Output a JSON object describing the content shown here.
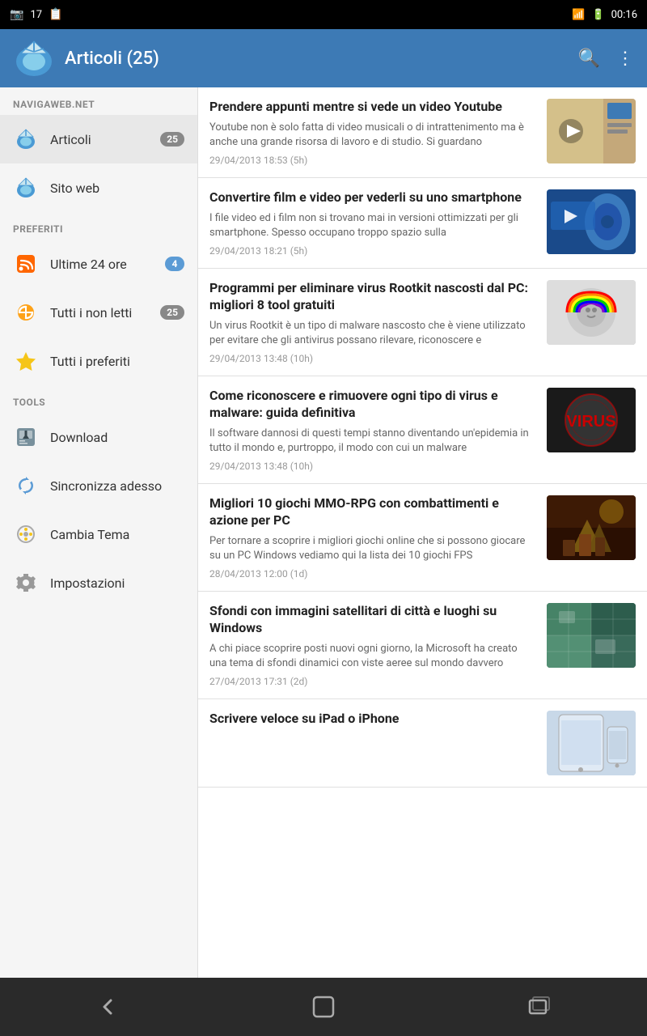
{
  "statusBar": {
    "leftIcons": [
      "📷",
      "17",
      "📋"
    ],
    "rightIcons": [
      "wifi",
      "battery",
      "time"
    ],
    "time": "00:16"
  },
  "topBar": {
    "title": "Articoli (25)",
    "searchLabel": "🔍",
    "menuLabel": "⋮"
  },
  "sidebar": {
    "sectionSite": "NAVIGAWEB.NET",
    "sectionFavorites": "PREFERITI",
    "sectionTools": "TOOLS",
    "items": [
      {
        "id": "articoli",
        "label": "Articoli",
        "badge": "25",
        "badgeClass": "badge",
        "icon": "articoli"
      },
      {
        "id": "sito-web",
        "label": "Sito web",
        "badge": "",
        "icon": "sito"
      },
      {
        "id": "ultime-24-ore",
        "label": "Ultime 24 ore",
        "badge": "4",
        "badgeClass": "badge blue",
        "icon": "rss"
      },
      {
        "id": "tutti-non-letti",
        "label": "Tutti i non letti",
        "badge": "25",
        "badgeClass": "badge",
        "icon": "wifi"
      },
      {
        "id": "tutti-preferiti",
        "label": "Tutti i preferiti",
        "badge": "",
        "icon": "star"
      },
      {
        "id": "download",
        "label": "Download",
        "badge": "",
        "icon": "download"
      },
      {
        "id": "sincronizza",
        "label": "Sincronizza adesso",
        "badge": "",
        "icon": "sync"
      },
      {
        "id": "cambia-tema",
        "label": "Cambia Tema",
        "badge": "",
        "icon": "theme"
      },
      {
        "id": "impostazioni",
        "label": "Impostazioni",
        "badge": "",
        "icon": "settings"
      }
    ]
  },
  "articles": [
    {
      "id": "art1",
      "title": "Prendere appunti mentre si vede un video Youtube",
      "excerpt": "Youtube non è solo fatta di video musicali o di intrattenimento ma è anche una grande risorsa di lavoro e di studio. Si guardano",
      "meta": "29/04/2013 18:53 (5h)",
      "thumbClass": "thumb-youtube",
      "thumbIcon": "🎬"
    },
    {
      "id": "art2",
      "title": "Convertire film e video per vederli su uno smartphone",
      "excerpt": "I file video ed i film non si trovano mai in versioni ottimizzati per gli smartphone. Spesso occupano troppo spazio sulla",
      "meta": "29/04/2013 18:21 (5h)",
      "thumbClass": "thumb-video",
      "thumbIcon": "📱"
    },
    {
      "id": "art3",
      "title": "Programmi per eliminare virus Rootkit nascosti dal PC: migliori 8 tool gratuiti",
      "excerpt": "Un virus Rootkit è un tipo di malware nascosto che è viene utilizzato per evitare che gli antivirus possano rilevare, riconoscere e",
      "meta": "29/04/2013 13:48 (10h)",
      "thumbClass": "thumb-virus",
      "thumbIcon": "🤖"
    },
    {
      "id": "art4",
      "title": "Come riconoscere e rimuovere ogni tipo di virus e malware: guida definitiva",
      "excerpt": "Il software dannosi di questi tempi stanno diventando un'epidemia in tutto il mondo e, purtroppo, il modo con cui un malware",
      "meta": "29/04/2013 13:48 (10h)",
      "thumbClass": "thumb-malware",
      "thumbIcon": "🦠"
    },
    {
      "id": "art5",
      "title": "Migliori 10 giochi MMO-RPG con combattimenti e azione per PC",
      "excerpt": "Per tornare a scoprire i migliori giochi online che si possono giocare su un PC Windows vediamo qui la lista dei 10 giochi FPS",
      "meta": "28/04/2013 12:00 (1d)",
      "thumbClass": "thumb-rpg",
      "thumbIcon": "⚔️"
    },
    {
      "id": "art6",
      "title": "Sfondi con immagini satellitari di città e luoghi su Windows",
      "excerpt": "A chi piace scoprire posti nuovi ogni giorno, la Microsoft ha creato una tema di sfondi dinamici con viste aeree sul mondo davvero",
      "meta": "27/04/2013 17:31 (2d)",
      "thumbClass": "thumb-satellite",
      "thumbIcon": "🛰️"
    },
    {
      "id": "art7",
      "title": "Scrivere veloce su iPad o iPhone",
      "excerpt": "",
      "meta": "",
      "thumbClass": "thumb-ipad",
      "thumbIcon": "📱"
    }
  ],
  "bottomNav": {
    "backIcon": "←",
    "homeIcon": "⬜",
    "recentIcon": "▭"
  }
}
